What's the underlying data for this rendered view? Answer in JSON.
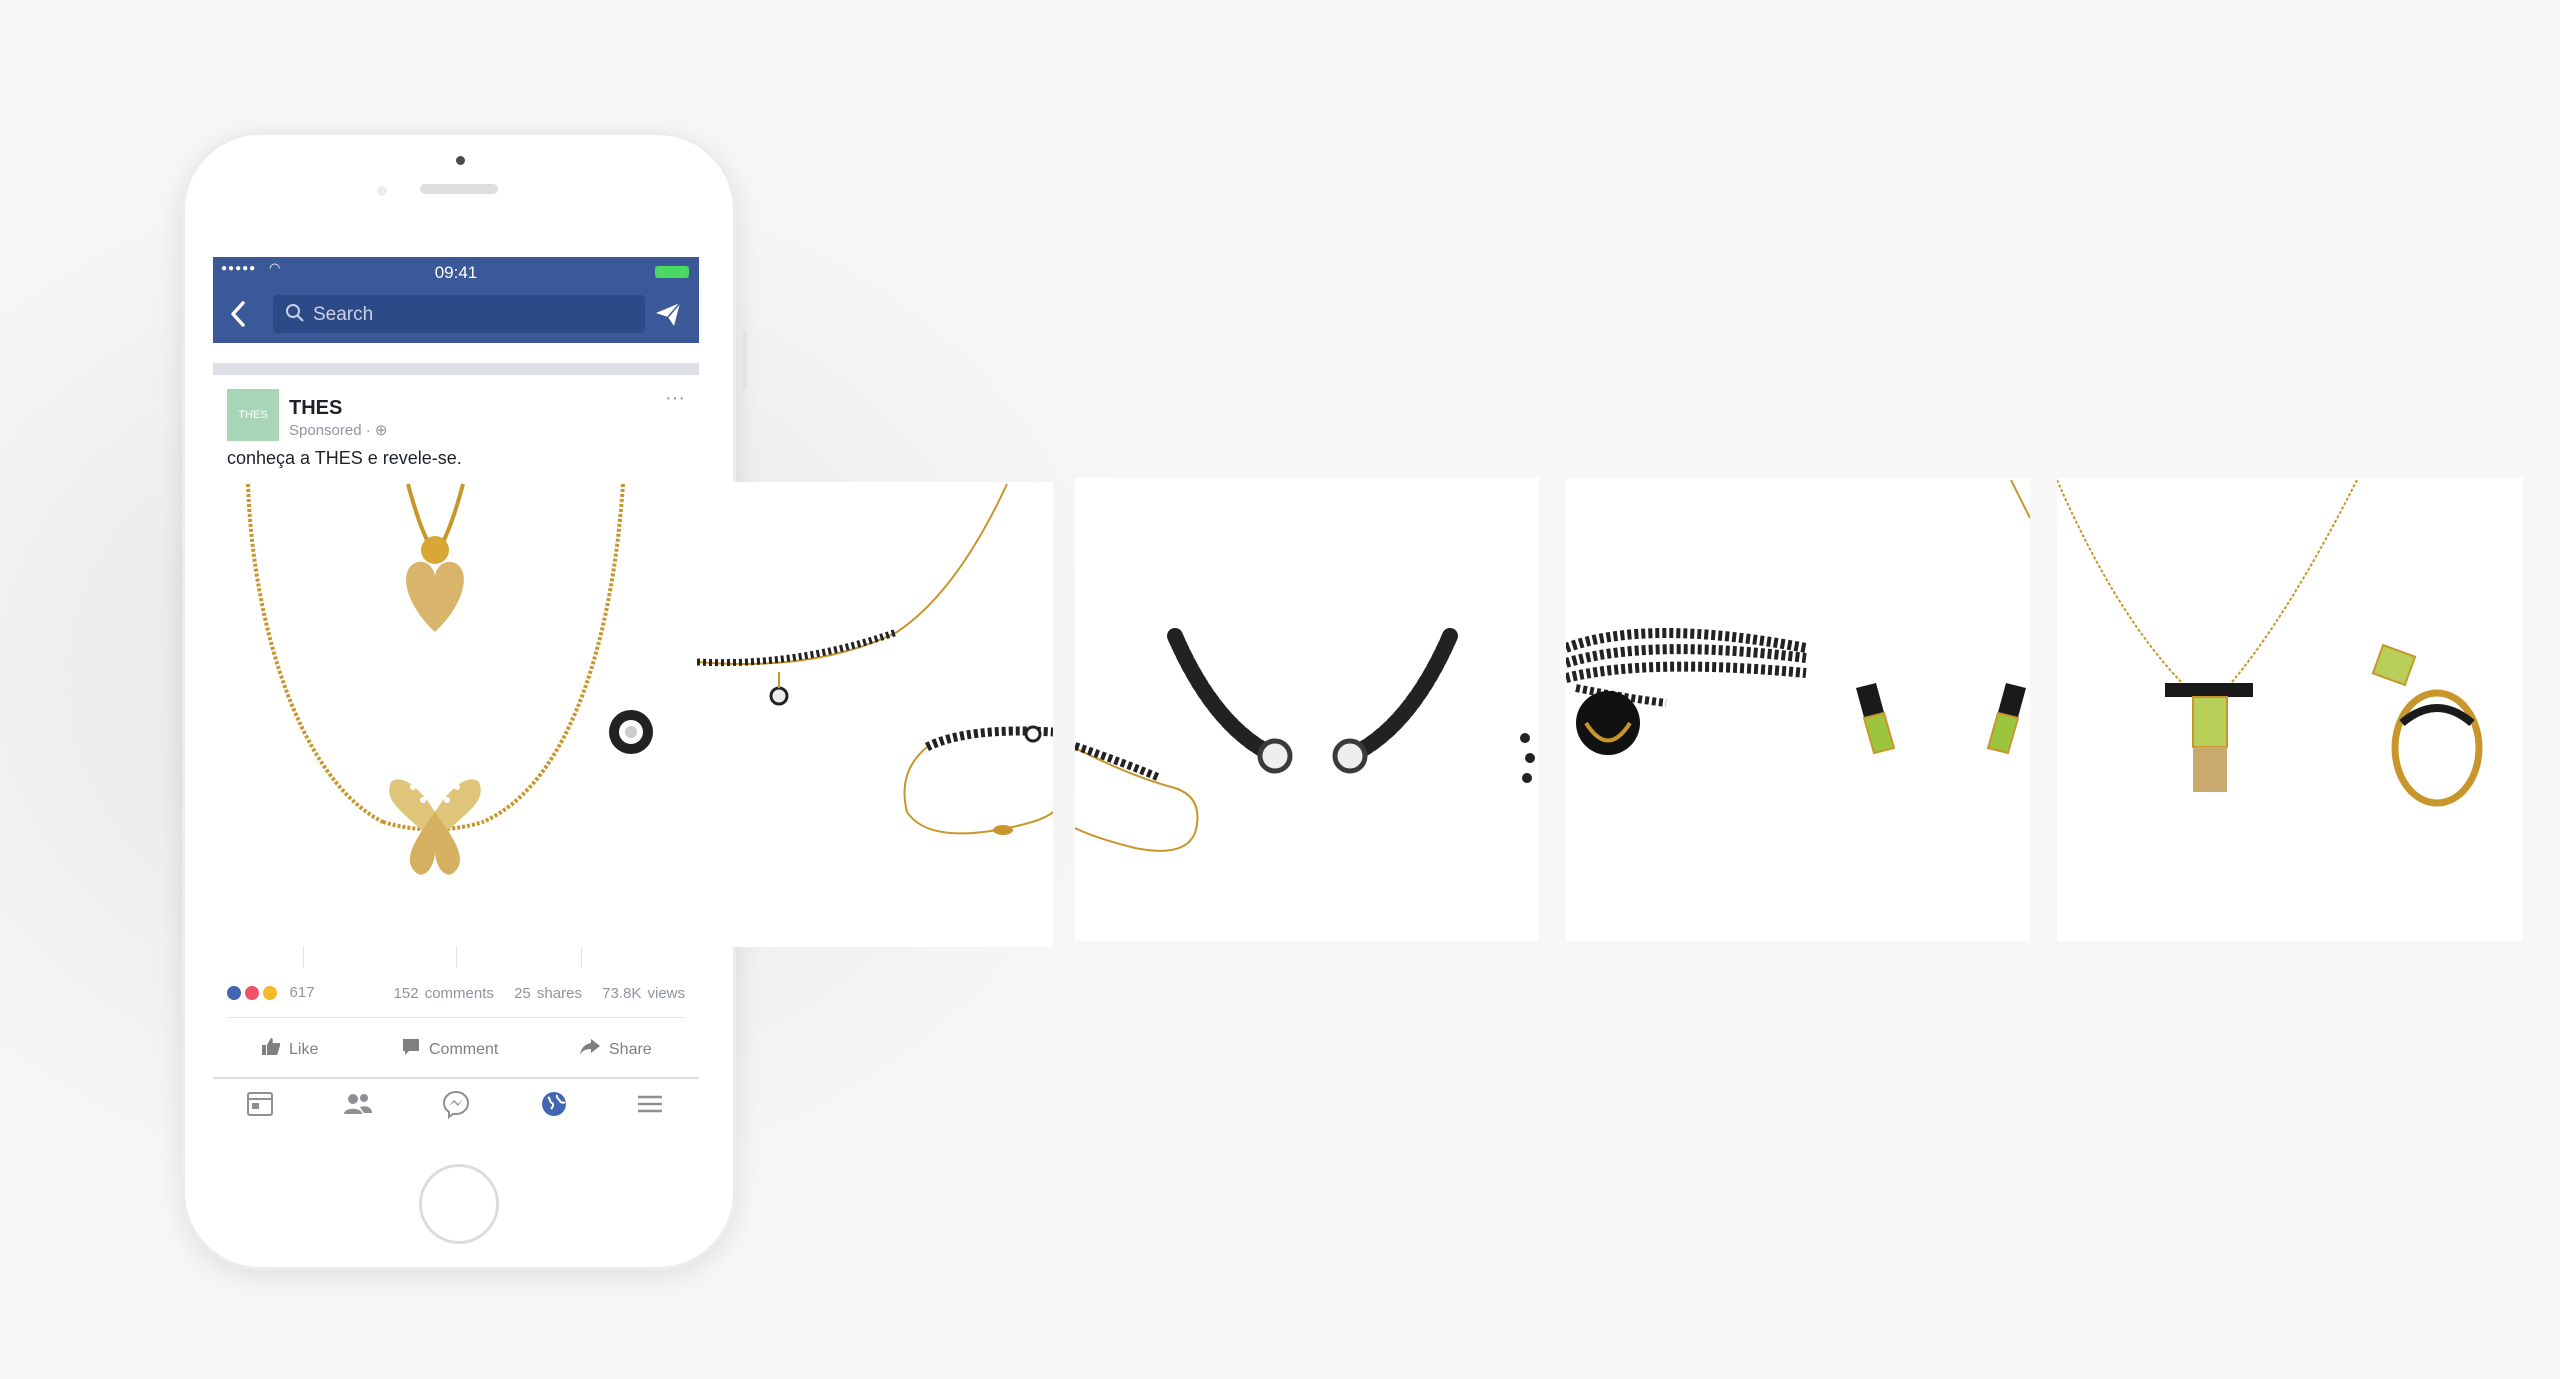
{
  "status_bar": {
    "time": "09:41"
  },
  "search": {
    "placeholder": "Search"
  },
  "post": {
    "page_name": "THES",
    "avatar_text": "THES",
    "meta": "Sponsored · ",
    "text": "conheça a THES e revele-se.",
    "reactions_count": "617",
    "comments": "152 comments",
    "shares": "25 shares",
    "views": "73.8K views"
  },
  "actions": {
    "like": "Like",
    "comment": "Comment",
    "share": "Share"
  },
  "tabs": [
    "news-feed",
    "friends",
    "messenger",
    "notifications-globe",
    "menu"
  ],
  "colors": {
    "facebook_blue": "#3b5998",
    "gold": "#d4a22a",
    "accent_blue": "#4267b2"
  },
  "carousel": [
    {
      "product": "gold heart and butterfly necklaces"
    },
    {
      "product": "diamond bar necklace and bracelet"
    },
    {
      "product": "crescent diamond earrings"
    },
    {
      "product": "black bead necklace and peridot earrings"
    },
    {
      "product": "peridot pendant and ring"
    }
  ]
}
